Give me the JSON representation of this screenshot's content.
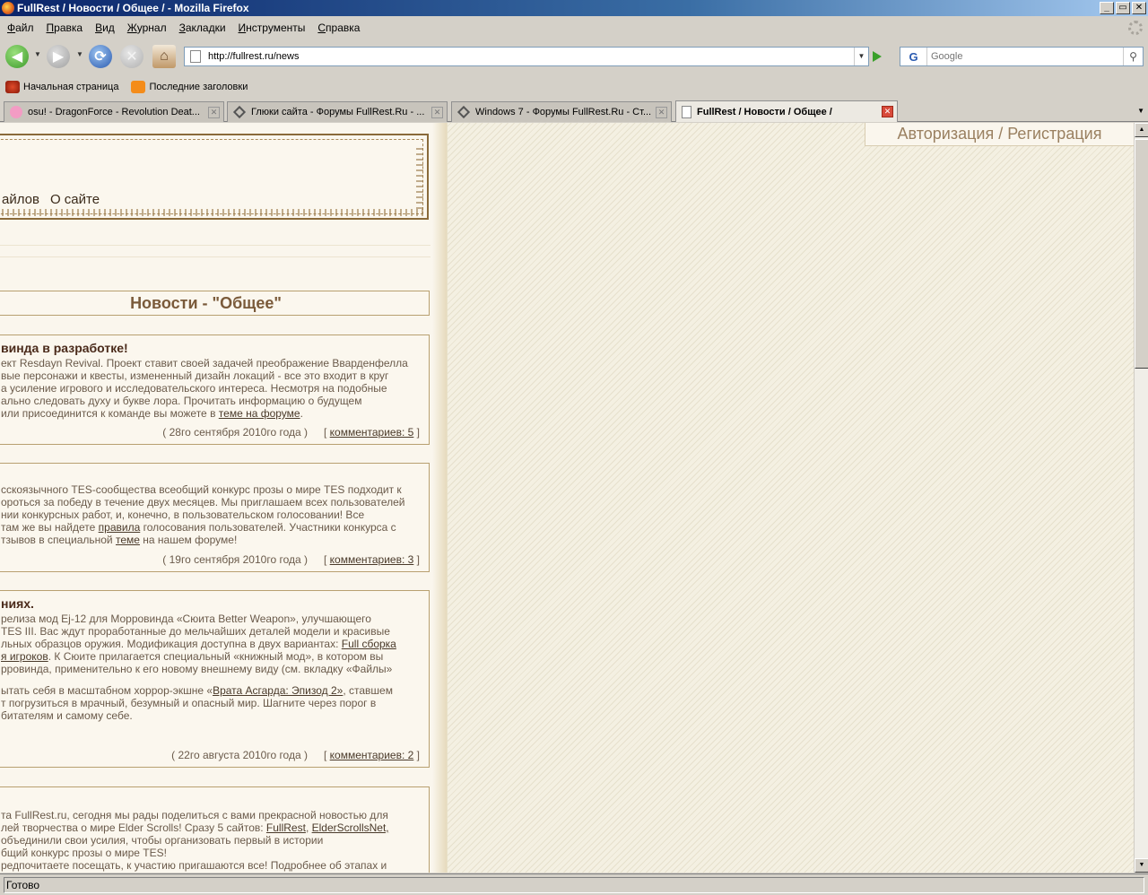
{
  "window": {
    "title": "FullRest / Новости / Общее / - Mozilla Firefox",
    "min_label": "_",
    "max_label": "▭",
    "close_label": "✕"
  },
  "menu": [
    "Файл",
    "Правка",
    "Вид",
    "Журнал",
    "Закладки",
    "Инструменты",
    "Справка"
  ],
  "nav": {
    "url": "http://fullrest.ru/news",
    "search_placeholder": "Google",
    "search_engine_glyph": "G"
  },
  "bookmarks": [
    "Начальная страница",
    "Последние заголовки"
  ],
  "tabs": [
    {
      "label": "osu! - DragonForce - Revolution Deat..."
    },
    {
      "label": "Глюки сайта - Форумы FullRest.Ru - ..."
    },
    {
      "label": "Windows 7 - Форумы FullRest.Ru - Ст..."
    },
    {
      "label": "FullRest / Новости / Общее /"
    }
  ],
  "page": {
    "auth_label": "Авторизация / Регистрация",
    "topnav": [
      "айлов",
      "О сайте"
    ],
    "section_title": "Новости - \"Общее\"",
    "news": [
      {
        "title": "винда в разработке!",
        "lines": [
          "ект Resdayn Revival. Проект ставит своей задачей преображение Вварденфелла,",
          "вые персонажи и квесты, измененный дизайн локаций - все это входит в круг",
          "а усиление игрового и исследовательского интереса. Несмотря на подобные",
          "ально следовать духу и букве лора. Прочитать информацию о будущем"
        ],
        "last_line_pre": "или присоединится к команде вы можете в ",
        "last_link": "теме на форуме",
        "last_line_post": ".",
        "date": "( 28го сентября 2010го года )",
        "comments": "комментариев: 5"
      },
      {
        "lines": [
          "сскоязычного TES-сообщества всеобщий конкурс прозы о мире TES подходит к",
          "ороться за победу в течение двух месяцев. Мы приглашаем всех пользователей",
          "нии конкурсных работ, и, конечно, в пользовательском голосовании! Все"
        ],
        "l4_pre": "там же вы найдете ",
        "l4_link": "правила",
        "l4_post": " голосования пользователей. Участники конкурса с",
        "l5_pre": "тзывов в специальной ",
        "l5_link": "теме",
        "l5_post": " на нашем форуме!",
        "date": "( 19го сентября 2010го года )",
        "comments": "комментариев: 3"
      },
      {
        "title": "ниях.",
        "l1": "релиза мод Ej-12 для Морровинда «Сюита Better Weapon», улучшающего",
        "l2": "TES III. Вас ждут проработанные до мельчайших деталей модели и красивые",
        "l3_pre": "льных образцов оружия. Модификация доступна в двух вариантах: ",
        "l3_link": "Full сборка",
        "l4_link": "я игроков",
        "l4_post": ". К Сюите прилагается специальный «книжный мод», в котором вы",
        "l5": "рровинда, применительно к его новому внешнему виду (см. вкладку «Файлы»",
        "p2_l1_pre": "ытать себя в масштабном хоррор-экшне «",
        "p2_l1_link": "Врата Асгарда: Эпизод 2»",
        "p2_l1_post": ", ставшем",
        "p2_l2": "т погрузиться в мрачный, безумный и опасный мир. Шагните через порог в",
        "p2_l3": "битателям и самому себе.",
        "date": "( 22го августа 2010го года )",
        "comments": "комментариев: 2"
      },
      {
        "l1": "та FullRest.ru, сегодня мы рады поделиться с вами прекрасной новостью для",
        "l2_pre": "лей творчества о мире Elder Scrolls! Сразу 5 сайтов: ",
        "l2_link1": "FullRest",
        "l2_sep": ", ",
        "l2_link2": "ElderScrollsNet,",
        "l3": " объединили свои усилия, чтобы организовать первый в истории",
        "l4": "бщий конкурс прозы о мире TES!",
        "l5": "редпочитаете посещать, к участию пригашаются все! Подробнее об этапах и"
      }
    ]
  },
  "status": "Готово"
}
